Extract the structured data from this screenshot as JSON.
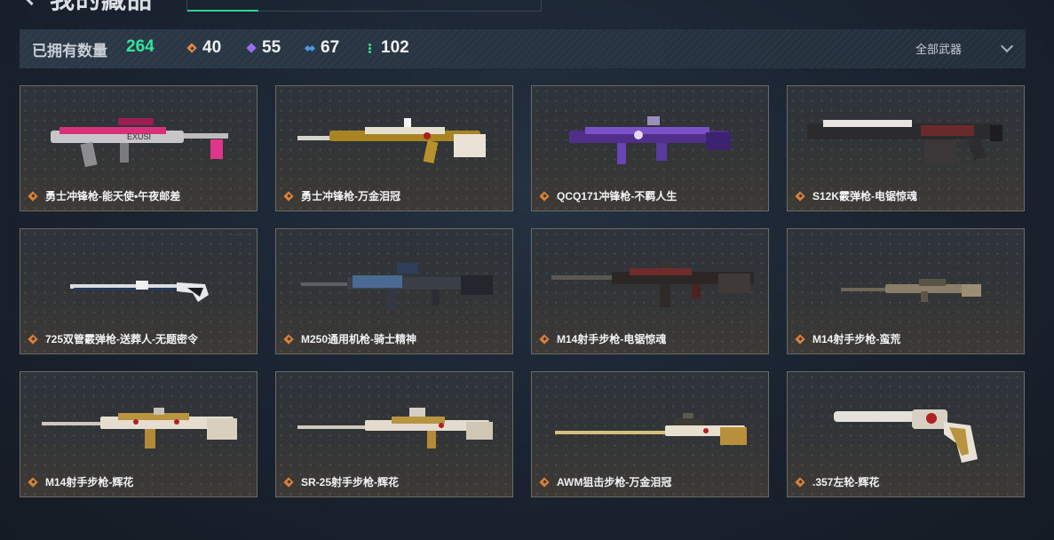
{
  "header": {
    "title": "我的藏品"
  },
  "stats": {
    "owned_label": "已拥有数量",
    "owned_total": "264",
    "tiers": [
      {
        "icon": "orange-diamond-icon",
        "count": "40",
        "color": "#e08a3c"
      },
      {
        "icon": "purple-diamond-icon",
        "count": "55",
        "color": "#9a6cf0"
      },
      {
        "icon": "blue-diamond-icon",
        "count": "67",
        "color": "#4a9ae8"
      },
      {
        "icon": "green-dots-icon",
        "count": "102",
        "color": "#35e39d"
      }
    ],
    "filter_label": "全部武器"
  },
  "items": [
    {
      "name": "勇士冲锋枪-能天使•午夜邮差",
      "rarity": "orange",
      "gun": "smg-pink"
    },
    {
      "name": "勇士冲锋枪-万金泪冠",
      "rarity": "orange",
      "gun": "smg-gold"
    },
    {
      "name": "QCQ171冲锋枪-不羁人生",
      "rarity": "orange",
      "gun": "smg-purple"
    },
    {
      "name": "S12K霰弹枪-电锯惊魂",
      "rarity": "orange",
      "gun": "shotgun-dark"
    },
    {
      "name": "725双管霰弹枪-送葬人-无题密令",
      "rarity": "orange",
      "gun": "double-barrel"
    },
    {
      "name": "M250通用机枪-骑士精神",
      "rarity": "orange",
      "gun": "lmg-blue"
    },
    {
      "name": "M14射手步枪-电锯惊魂",
      "rarity": "orange",
      "gun": "rifle-dark"
    },
    {
      "name": "M14射手步枪-蛮荒",
      "rarity": "orange",
      "gun": "rifle-camo"
    },
    {
      "name": "M14射手步枪-辉花",
      "rarity": "orange",
      "gun": "rifle-white"
    },
    {
      "name": "SR-25射手步枪-辉花",
      "rarity": "orange",
      "gun": "sr25-white"
    },
    {
      "name": "AWM狙击步枪-万金泪冠",
      "rarity": "orange",
      "gun": "sniper-gold"
    },
    {
      "name": ".357左轮-辉花",
      "rarity": "orange",
      "gun": "revolver-white"
    }
  ]
}
